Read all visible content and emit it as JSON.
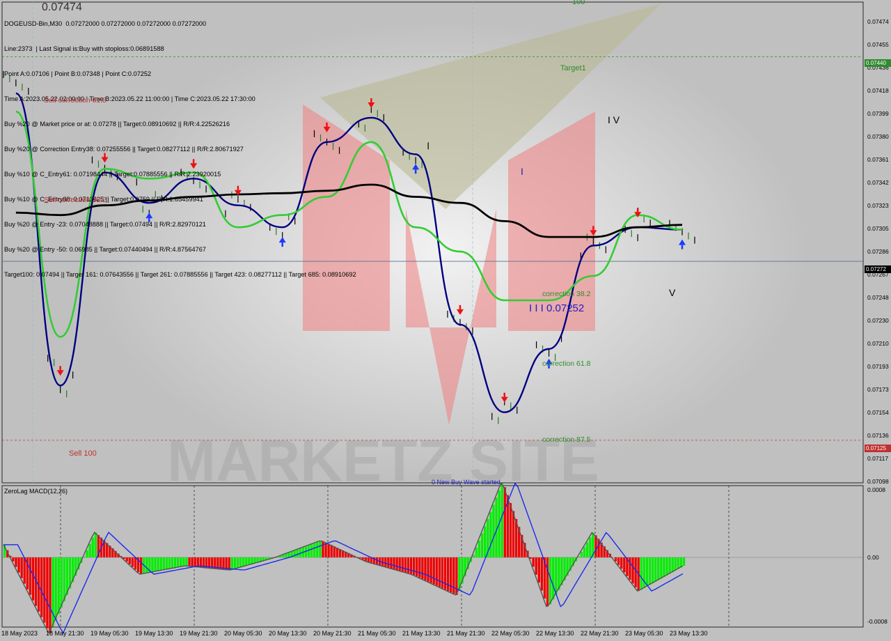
{
  "header": {
    "symbol_line": "DOGEUSD-Bin,M30  0.07272000 0.07272000 0.07272000 0.07272000",
    "lines": [
      "Line:2373  | Last Signal is:Buy with stoploss:0.06891588",
      "Point A:0.07106 | Point B:0.07348 | Point C:0.07252",
      "Time A:2023.05.22 02:00:00 | Time B:2023.05.22 11:00:00 | Time C:2023.05.22 17:30:00",
      "Buy %20 @ Market price or at: 0.07278 || Target:0.08910692 || R/R:4.22526216",
      "Buy %20 @ Correction Entry38: 0.07255556 || Target:0.08277112 || R/R:2.80671927",
      "Buy %10 @ C_Entry61: 0.07198444 || Target:0.07885556 || R/R:2.23920015",
      "Buy %10 @ C_Entry88: 0.0713625 || Target:0.0759 || R/R:1.85459941",
      "Buy %20 @ Entry -23: 0.07048888 || Target:0.07494 || R/R:2.82970121",
      "Buy %20 @ Entry -50: 0.06985 || Target:0.07440494 || R/R:4.87564767",
      "Target100: 0.07494 || Target 161: 0.07643556 || Target 261: 0.07885556 || Target 423: 0.08277112 || Target 685: 0.08910692"
    ],
    "overlay_price": "0.07474"
  },
  "annotations": {
    "target1": "Target1",
    "top_100": "100",
    "sell_correction_618": "Sell correction 61.8",
    "sell_correction_382": "Sell correction 38.2",
    "sell_100": "Sell 100",
    "correction_382": "correction 38.2",
    "correction_618": "correction 61.8",
    "correction_875": "correction 87.5",
    "wave_point_c": "I I I 0.07252",
    "wave_i": "I",
    "wave_iv": "I V",
    "wave_v": "V",
    "watermark": "MARKETZ SITE",
    "bottom_text": "0 New Buy Wave started"
  },
  "price_axis": {
    "ticks": [
      "0.07474",
      "0.07455",
      "0.07436",
      "0.07418",
      "0.07399",
      "0.07380",
      "0.07361",
      "0.07342",
      "0.07323",
      "0.07305",
      "0.07286",
      "0.07267",
      "0.07248",
      "0.07230",
      "0.07210",
      "0.07193",
      "0.07173",
      "0.07154",
      "0.07136",
      "0.07117",
      "0.07098"
    ],
    "tag_target": "0.07440",
    "tag_current": "0.07272",
    "tag_sell100": "0.07125"
  },
  "macd_panel": {
    "title": "ZeroLag MACD(12,26)",
    "ticks": [
      "0.0008",
      "0.00",
      "-0.0008"
    ]
  },
  "time_axis": [
    "18 May 2023",
    "18 May 21:30",
    "19 May 05:30",
    "19 May 13:30",
    "19 May 21:30",
    "20 May 05:30",
    "20 May 13:30",
    "20 May 21:30",
    "21 May 05:30",
    "21 May 13:30",
    "21 May 21:30",
    "22 May 05:30",
    "22 May 13:30",
    "22 May 21:30",
    "23 May 05:30",
    "23 May 13:30"
  ],
  "colors": {
    "background": "#c0c0c0",
    "green_line": "#33cc33",
    "navy_line": "#000080",
    "black_line": "#000000",
    "target_line": "#2e8b2e",
    "sell_line": "#cc3333",
    "current_line": "#5a6e8c",
    "tag_green": "#2e8b2e",
    "tag_red": "#c03030",
    "tag_dark": "#000000"
  },
  "chart_data": {
    "type": "line",
    "title": "DOGEUSD-Bin,M30",
    "x": [
      "18 May 2023",
      "18 May 21:30",
      "19 May 05:30",
      "19 May 13:30",
      "19 May 21:30",
      "20 May 05:30",
      "20 May 13:30",
      "20 May 21:30",
      "21 May 05:30",
      "21 May 13:30",
      "21 May 21:30",
      "22 May 05:30",
      "22 May 13:30",
      "22 May 21:30",
      "23 May 05:30",
      "23 May 13:30"
    ],
    "series": [
      {
        "values": [
          0.0741,
          0.0717,
          0.07345,
          0.0732,
          0.0734,
          0.07318,
          0.073,
          0.0737,
          0.0739,
          0.0736,
          0.0722,
          0.07148,
          0.072,
          0.07285,
          0.073,
          0.07298
        ]
      },
      {
        "values": [
          0.07395,
          0.0721,
          0.07348,
          0.0734,
          0.07345,
          0.073,
          0.0731,
          0.07325,
          0.0737,
          0.073,
          0.0728,
          0.0724,
          0.0724,
          0.0726,
          0.0731,
          0.07298
        ]
      },
      {
        "values": [
          0.07312,
          0.0731,
          0.07318,
          0.07322,
          0.07325,
          0.07327,
          0.07328,
          0.0733,
          0.07335,
          0.07325,
          0.0732,
          0.07305,
          0.07292,
          0.07292,
          0.073,
          0.07302
        ]
      }
    ],
    "levels": {
      "target1": 0.0744,
      "current": 0.07272,
      "sell100": 0.07125
    },
    "macd": [
      0.00015,
      -0.0009,
      0.0003,
      -0.0002,
      -0.0001,
      -0.00015,
      0.0,
      0.0002,
      -5e-05,
      -0.0002,
      -0.00045,
      0.0009,
      -0.0006,
      0.0003,
      -0.0004,
      -0.0001
    ],
    "ylim": [
      0.0709,
      0.07485
    ]
  }
}
